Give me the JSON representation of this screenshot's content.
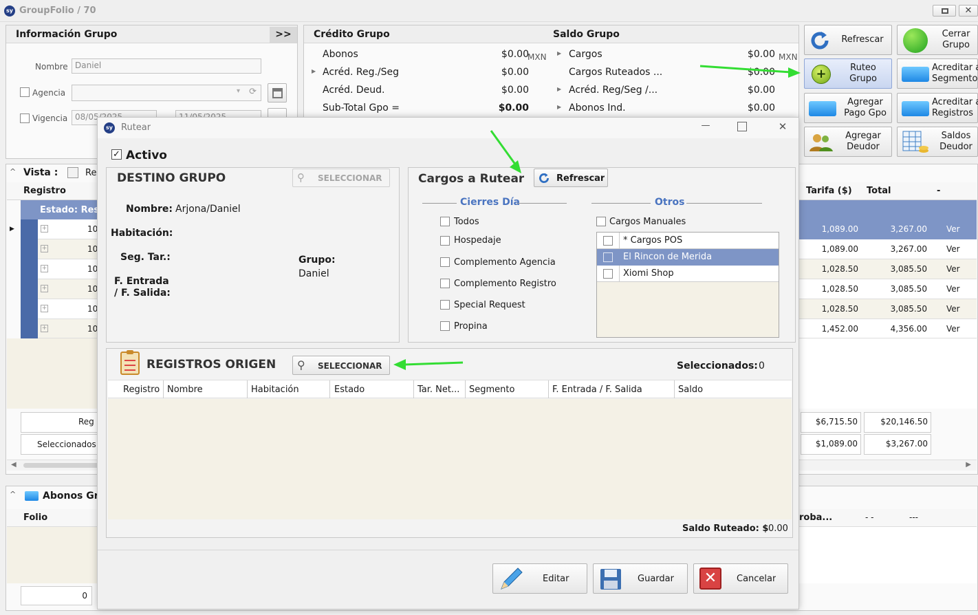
{
  "app": {
    "logo": "sy",
    "title": "GroupFolio / 70"
  },
  "info_grupo": {
    "title": "Información Grupo",
    "expand": ">>",
    "nombre_label": "Nombre",
    "nombre_value": "Daniel",
    "agencia_label": "Agencia",
    "vigencia_label": "Vigencia",
    "vigencia_from": "08/05/2025",
    "vigencia_to": "11/05/2025"
  },
  "credito": {
    "title": "Crédito Grupo",
    "rows": [
      {
        "label": "Abonos",
        "value": "$0.00",
        "unit": "MXN"
      },
      {
        "label": "Acréd. Reg./Seg",
        "value": "$0.00"
      },
      {
        "label": "Acréd. Deud.",
        "value": "$0.00"
      },
      {
        "label": "Sub-Total Gpo  =",
        "value": "$0.00"
      }
    ]
  },
  "saldo": {
    "title": "Saldo Grupo",
    "rows": [
      {
        "label": "Cargos",
        "value": "$0.00",
        "unit": "MXN"
      },
      {
        "label": "Cargos Ruteados ...",
        "value": "$0.00"
      },
      {
        "label": "Acréd. Reg/Seg /...",
        "value": "$0.00"
      },
      {
        "label": "Abonos Ind.",
        "value": "$0.00"
      }
    ]
  },
  "actions": [
    {
      "label": "Refrescar",
      "icon": "refresh-icon"
    },
    {
      "label": "Cerrar\nGrupo",
      "icon": "green-circle-icon"
    },
    {
      "label": "Ruteo\nGrupo",
      "icon": "add-green-icon"
    },
    {
      "label": "Acreditar a\nSegmentos",
      "icon": "card-icon"
    },
    {
      "label": "Agregar\nPago Gpo",
      "icon": "card-icon"
    },
    {
      "label": "Acreditar a\nRegistros",
      "icon": "card-icon"
    },
    {
      "label": "Agregar\nDeudor",
      "icon": "users-icon"
    },
    {
      "label": "Saldos\nDeudor",
      "icon": "calc-coins-icon"
    }
  ],
  "vista": {
    "label": "Vista :",
    "tab": "Re",
    "col_registro": "Registro",
    "group_row": "Estado: Res",
    "reg_prefix": "10",
    "columns_right": [
      "Tarifa ($)",
      "Total",
      "-"
    ],
    "rows": [
      {
        "tarifa": "1,089.00",
        "total": "3,267.00",
        "link": "Ver"
      },
      {
        "tarifa": "1,089.00",
        "total": "3,267.00",
        "link": "Ver"
      },
      {
        "tarifa": "1,028.50",
        "total": "3,085.50",
        "link": "Ver"
      },
      {
        "tarifa": "1,028.50",
        "total": "3,085.50",
        "link": "Ver"
      },
      {
        "tarifa": "1,028.50",
        "total": "3,085.50",
        "link": "Ver"
      },
      {
        "tarifa": "1,452.00",
        "total": "4,356.00",
        "link": "Ver"
      }
    ],
    "sum_reg_label": "Reg",
    "sum_reg_tarifa": "$6,715.50",
    "sum_reg_total": "$20,146.50",
    "sum_sel_label": "Seleccionados",
    "sum_sel_tarifa": "$1,089.00",
    "sum_sel_total": "$3,267.00"
  },
  "abonos": {
    "title": "Abonos Gr",
    "col_folio": "Folio",
    "col_comp": "roba...",
    "col_a": "- -",
    "col_b": "---",
    "footer_value": "0"
  },
  "dialog": {
    "title": "Rutear",
    "activo": "Activo",
    "destino": {
      "title": "DESTINO GRUPO",
      "select": "SELECCIONAR",
      "nombre_label": "Nombre:",
      "nombre_value": "Arjona/Daniel",
      "habitacion_label": "Habitación:",
      "segtar_label": "Seg. Tar.:",
      "entrada_label": "F. Entrada\n/ F. Salida:",
      "grupo_label": "Grupo:",
      "grupo_value": "Daniel"
    },
    "cargos": {
      "title": "Cargos a Rutear",
      "refresh": "Refrescar",
      "cierres_title": "Cierres Día",
      "cierres": [
        "Todos",
        "Hospedaje",
        "Complemento Agencia",
        "Complemento Registro",
        "Special Request",
        "Propina"
      ],
      "otros_title": "Otros",
      "manuales": "Cargos Manuales",
      "otros_list": [
        "* Cargos POS",
        "El Rincon de Merida",
        "Xiomi Shop"
      ]
    },
    "origen": {
      "title": "REGISTROS ORIGEN",
      "select": "SELECCIONAR",
      "sel_label": "Seleccionados:",
      "sel_value": "0",
      "columns": [
        "Registro",
        "Nombre",
        "Habitación",
        "Estado",
        "Tar. Net...",
        "Segmento",
        "F. Entrada / F. Salida",
        "Saldo"
      ],
      "saldo_label": "Saldo Ruteado: $",
      "saldo_value": "0.00"
    },
    "buttons": {
      "editar": "Editar",
      "guardar": "Guardar",
      "cancelar": "Cancelar"
    }
  },
  "colors": {
    "accent": "#7e95c6",
    "arrow": "#33dd33"
  }
}
